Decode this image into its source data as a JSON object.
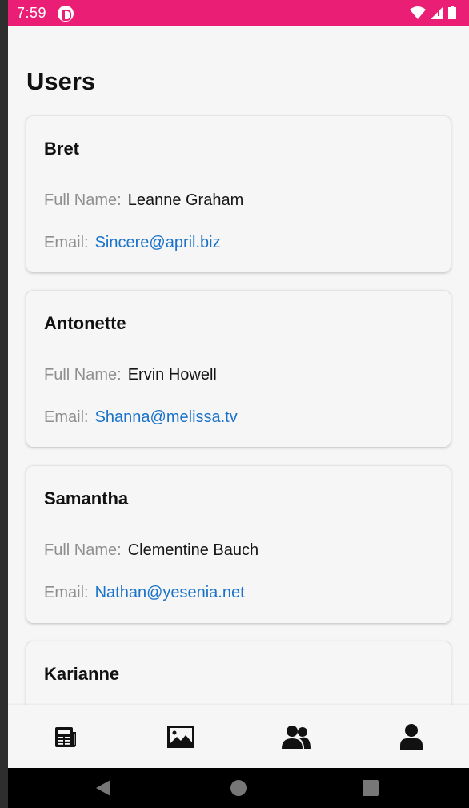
{
  "status_bar": {
    "time": "7:59",
    "color": "#e91e74"
  },
  "page": {
    "title": "Users"
  },
  "labels": {
    "full_name": "Full Name:",
    "email": "Email:"
  },
  "users": [
    {
      "username": "Bret",
      "full_name": "Leanne Graham",
      "email": "Sincere@april.biz"
    },
    {
      "username": "Antonette",
      "full_name": "Ervin Howell",
      "email": "Shanna@melissa.tv"
    },
    {
      "username": "Samantha",
      "full_name": "Clementine Bauch",
      "email": "Nathan@yesenia.net"
    },
    {
      "username": "Karianne"
    }
  ],
  "tabs": [
    {
      "icon": "newspaper-icon"
    },
    {
      "icon": "image-icon"
    },
    {
      "icon": "users-icon"
    },
    {
      "icon": "user-icon"
    }
  ],
  "nav": {
    "buttons": [
      "back-icon",
      "home-icon",
      "recents-icon"
    ]
  },
  "colors": {
    "accent": "#e91e74",
    "link": "#1a73c9",
    "label": "#8f8f8f"
  }
}
